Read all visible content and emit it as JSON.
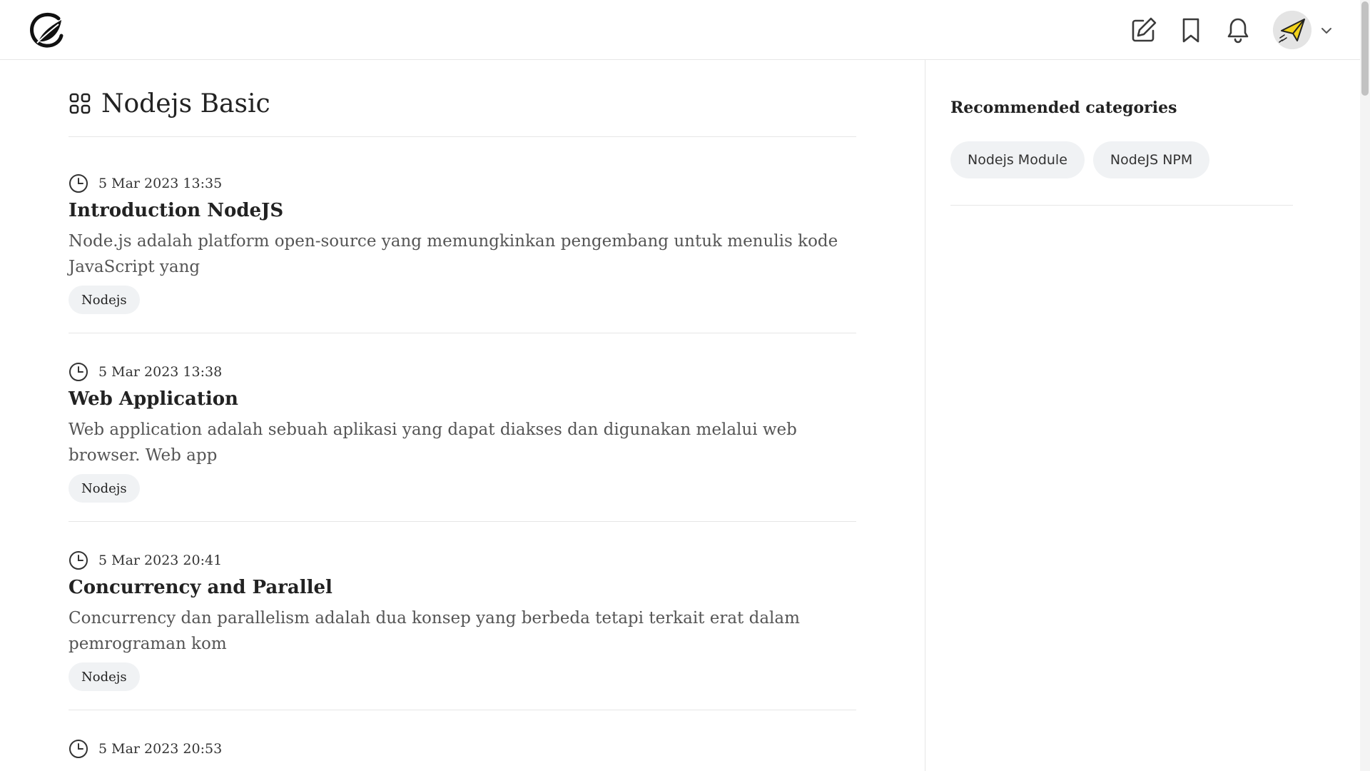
{
  "header": {
    "logo_icon": "leaf-c-logo-icon",
    "actions": [
      "write-icon",
      "bookmark-icon",
      "bell-icon"
    ],
    "avatar_icon": "paper-plane-avatar",
    "menu_icon": "chevron-down-icon"
  },
  "page": {
    "title": "Nodejs Basic",
    "title_icon": "grid-icon"
  },
  "articles": [
    {
      "date": "5 Mar 2023 13:35",
      "title": "Introduction NodeJS",
      "excerpt": "Node.js adalah platform open-source yang memungkinkan pengembang untuk menulis kode JavaScript yang",
      "tag": "Nodejs"
    },
    {
      "date": "5 Mar 2023 13:38",
      "title": "Web Application",
      "excerpt": "Web application adalah sebuah aplikasi yang dapat diakses dan digunakan melalui web browser. Web app",
      "tag": "Nodejs"
    },
    {
      "date": "5 Mar 2023 20:41",
      "title": "Concurrency and Parallel",
      "excerpt": "Concurrency dan parallelism adalah dua konsep yang berbeda tetapi terkait erat dalam pemrograman kom",
      "tag": "Nodejs"
    },
    {
      "date": "5 Mar 2023 20:53"
    }
  ],
  "sidebar": {
    "title": "Recommended categories",
    "categories": [
      "Nodejs Module",
      "NodeJS NPM"
    ]
  },
  "colors": {
    "text": "#222222",
    "muted": "#555555",
    "chip_bg": "#f0f2f4",
    "border": "#e6e6e6",
    "avatar_plane": "#f2d21b"
  }
}
